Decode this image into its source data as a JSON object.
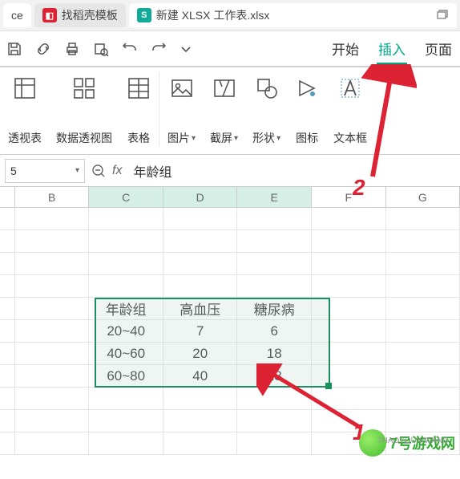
{
  "tabs": {
    "left_label": "ce",
    "doc_label": "找稻壳模板",
    "xls_label": "新建 XLSX 工作表.xlsx",
    "xls_badge": "S"
  },
  "menu": {
    "start": "开始",
    "insert": "插入",
    "page": "页面"
  },
  "ribbon": {
    "pivot_table": "透视表",
    "pivot_chart": "数据透视图",
    "table": "表格",
    "pic": "图片",
    "shot": "截屏",
    "shape": "形状",
    "icon": "图标",
    "text": "文本框"
  },
  "fbar": {
    "name": "5",
    "fx": "fx",
    "val": "年龄组"
  },
  "cols": {
    "B": "B",
    "C": "C",
    "D": "D",
    "E": "E",
    "F": "F",
    "G": "G"
  },
  "table": {
    "h1": "年龄组",
    "h2": "高血压",
    "h3": "糖尿病",
    "r1": [
      "20~40",
      "7",
      "6"
    ],
    "r2": [
      "40~60",
      "20",
      "18"
    ],
    "r3": [
      "60~80",
      "40",
      "28"
    ]
  },
  "anno": {
    "n1": "1",
    "n2": "2"
  },
  "wm": {
    "t": "7号游戏网",
    "s": "7HAOYOUXIWANG"
  }
}
